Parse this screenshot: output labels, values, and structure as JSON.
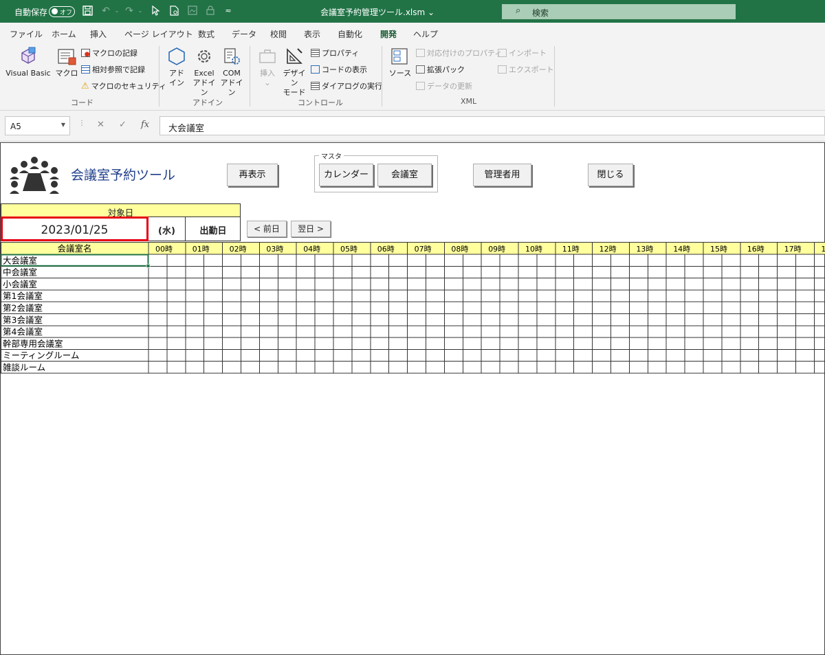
{
  "window": {
    "autosave_label": "自動保存",
    "autosave_state": "オフ",
    "file_title": "会議室予約管理ツール.xlsm",
    "search_placeholder": "検索"
  },
  "ribbon": {
    "tabs": [
      "ファイル",
      "ホーム",
      "挿入",
      "ページ レイアウト",
      "数式",
      "データ",
      "校閲",
      "表示",
      "自動化",
      "開発",
      "ヘルプ"
    ],
    "active_tab": "開発",
    "code": {
      "visual_basic": "Visual Basic",
      "macro": "マクロ",
      "record_macro": "マクロの記録",
      "relative_ref": "相対参照で記録",
      "macro_security": "マクロのセキュリティ",
      "group": "コード"
    },
    "addins": {
      "addin_1": "アド",
      "addin_2": "イン",
      "excel_addin_1": "Excel",
      "excel_addin_2": "アドイン",
      "com_addin_1": "COM",
      "com_addin_2": "アドイン",
      "group": "アドイン"
    },
    "controls": {
      "insert": "挿入",
      "design_mode_1": "デザイン",
      "design_mode_2": "モード",
      "properties": "プロパティ",
      "view_code": "コードの表示",
      "run_dialog": "ダイアログの実行",
      "group": "コントロール"
    },
    "xml": {
      "source": "ソース",
      "map_properties": "対応付けのプロパティ",
      "expansion_packs": "拡張パック",
      "refresh_data": "データの更新",
      "import": "インポート",
      "export": "エクスポート",
      "group": "XML"
    }
  },
  "formula_bar": {
    "cell_ref": "A5",
    "content": "大会議室"
  },
  "sheet": {
    "tool_title": "会議室予約ツール",
    "buttons": {
      "refresh": "再表示",
      "master_caption": "マスタ",
      "calendar": "カレンダー",
      "meeting_room": "会議室",
      "admin": "管理者用",
      "close": "閉じる",
      "prev_day": "< 前日",
      "next_day": "翌日 >"
    },
    "target_date_label": "対象日",
    "date": "2023/01/25",
    "weekday": "(水)",
    "day_type": "出勤日",
    "room_header": "会議室名",
    "hours": [
      "00時",
      "01時",
      "02時",
      "03時",
      "04時",
      "05時",
      "06時",
      "07時",
      "08時",
      "09時",
      "10時",
      "11時",
      "12時",
      "13時",
      "14時",
      "15時",
      "16時",
      "17時",
      "1"
    ],
    "rooms": [
      "大会議室",
      "中会議室",
      "小会議室",
      "第1会議室",
      "第2会議室",
      "第3会議室",
      "第4会議室",
      "幹部専用会議室",
      "ミーティングルーム",
      "雑談ルーム"
    ]
  },
  "colors": {
    "excel_green": "#217346",
    "header_yellow": "#ffff9e",
    "highlight_red": "#e60012",
    "title_blue": "#1f3d8a"
  }
}
